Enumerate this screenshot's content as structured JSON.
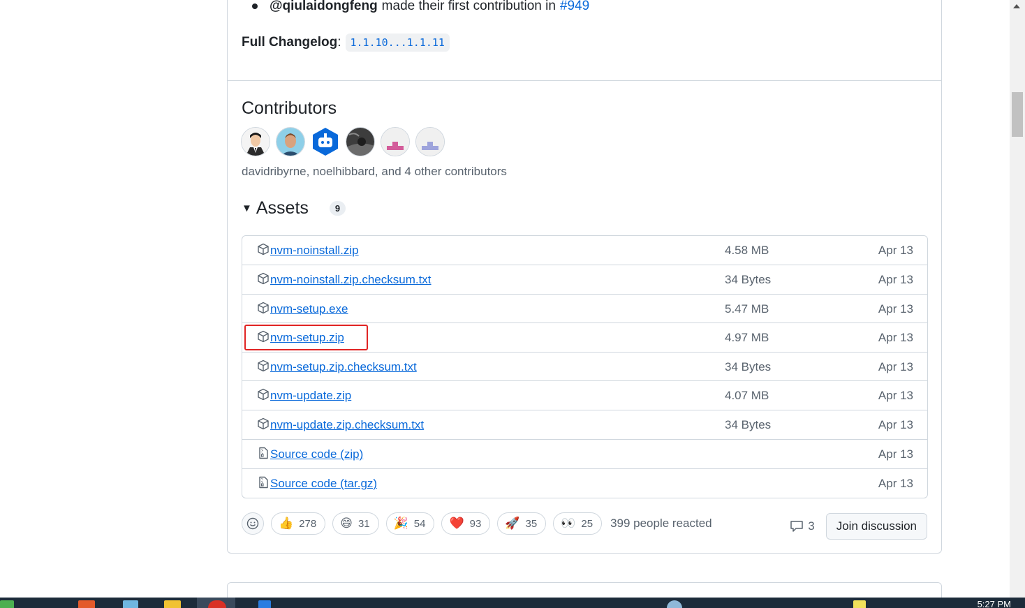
{
  "new_contributor": {
    "user": "@qiulaidongfeng",
    "text": "made their first contribution in",
    "pr": "#949"
  },
  "changelog": {
    "label": "Full Changelog",
    "colon": ":",
    "range": "1.1.10...1.1.11"
  },
  "contributors": {
    "heading": "Contributors",
    "summary": "davidribyrne, noelhibbard, and 4 other contributors"
  },
  "assets": {
    "heading": "Assets",
    "count": "9",
    "items": [
      {
        "name": "nvm-noinstall.zip",
        "suffix": "",
        "size": "4.58 MB",
        "date": "Apr 13",
        "icon": "package-icon"
      },
      {
        "name": "nvm-noinstall.zip.checksum.txt",
        "suffix": "",
        "size": "34 Bytes",
        "date": "Apr 13",
        "icon": "package-icon"
      },
      {
        "name": "nvm-setup.exe",
        "suffix": "",
        "size": "5.47 MB",
        "date": "Apr 13",
        "icon": "package-icon"
      },
      {
        "name": "nvm-setup.zip",
        "suffix": "",
        "size": "4.97 MB",
        "date": "Apr 13",
        "icon": "package-icon"
      },
      {
        "name": "nvm-setup.zip.checksum.txt",
        "suffix": "",
        "size": "34 Bytes",
        "date": "Apr 13",
        "icon": "package-icon"
      },
      {
        "name": "nvm-update.zip",
        "suffix": "",
        "size": "4.07 MB",
        "date": "Apr 13",
        "icon": "package-icon"
      },
      {
        "name": "nvm-update.zip.checksum.txt",
        "suffix": "",
        "size": "34 Bytes",
        "date": "Apr 13",
        "icon": "package-icon"
      },
      {
        "name": "Source code",
        "suffix": "(zip)",
        "size": "",
        "date": "Apr 13",
        "icon": "file-zip-icon"
      },
      {
        "name": "Source code",
        "suffix": "(tar.gz)",
        "size": "",
        "date": "Apr 13",
        "icon": "file-zip-icon"
      }
    ]
  },
  "reactions": {
    "items": [
      {
        "emoji": "👍",
        "count": "278",
        "name": "thumbs-up"
      },
      {
        "emoji": "😄",
        "count": "31",
        "name": "laugh"
      },
      {
        "emoji": "🎉",
        "count": "54",
        "name": "hooray"
      },
      {
        "emoji": "❤️",
        "count": "93",
        "name": "heart"
      },
      {
        "emoji": "🚀",
        "count": "35",
        "name": "rocket"
      },
      {
        "emoji": "👀",
        "count": "25",
        "name": "eyes"
      }
    ],
    "summary": "399 people reacted"
  },
  "discussion": {
    "comment_count": "3",
    "join_label": "Join discussion"
  },
  "taskbar": {
    "clock": "5:27 PM"
  },
  "colors": {
    "link": "#0969da",
    "border": "#d0d7de",
    "muted": "#59636e",
    "highlight": "#e02424"
  }
}
